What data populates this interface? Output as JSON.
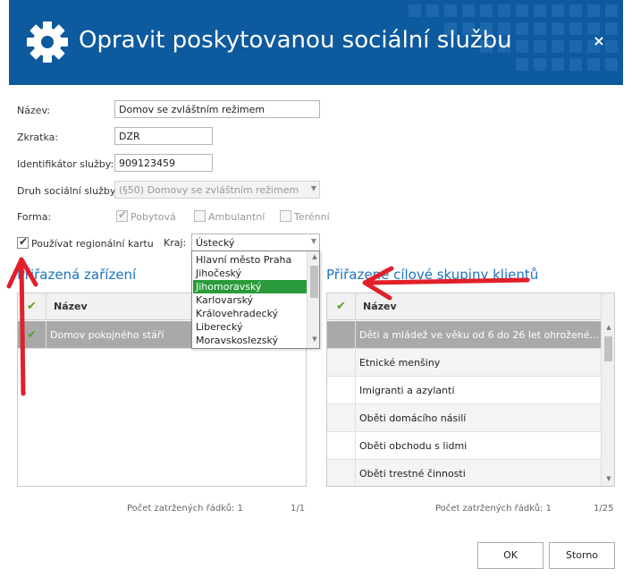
{
  "dialog": {
    "title": "Opravit poskytovanou sociální službu",
    "close_label": "×",
    "accent": "#0e5a9e",
    "gear_icon": "gear-icon"
  },
  "form": {
    "nazev_label": "Název:",
    "nazev_value": "Domov se zvláštním režimem",
    "zkratka_label": "Zkratka:",
    "zkratka_value": "DZR",
    "identifikator_label": "Identifikátor služby:",
    "identifikator_value": "909123459",
    "druh_label": "Druh sociální služby:",
    "druh_value": "(§50) Domovy se zvláštním režimem",
    "forma_label": "Forma:",
    "forma_options": [
      {
        "label": "Pobytová",
        "checked": true
      },
      {
        "label": "Ambulantní",
        "checked": false
      },
      {
        "label": "Terénní",
        "checked": false
      }
    ],
    "regional_label": "Používat regionální kartu",
    "regional_checked": true,
    "kraj_label": "Kraj:",
    "kraj_value": "Ústecký"
  },
  "kraj_dropdown": {
    "items": [
      "Hlavní město Praha",
      "Jihočeský",
      "Jihomoravský",
      "Karlovarský",
      "Královehradecký",
      "Liberecký",
      "Moravskoslezský"
    ],
    "selected_index": 2,
    "selected_color": "#2a9b3a"
  },
  "zarizeni": {
    "title": "Přiřazená zařízení",
    "column": "Název",
    "rows": [
      "Domov pokojného stáří"
    ],
    "count_text": "Počet zatržených řádků: 1",
    "page_text": "1/1"
  },
  "skupiny": {
    "title": "Přiřazené cílové skupiny klientů",
    "column": "Název",
    "rows": [
      "Děti a mládež ve věku od 6 do 26 let ohrožené...",
      "Etnické menšiny",
      "Imigranti a azylanti",
      "Oběti domácího násilí",
      "Oběti obchodu s lidmi",
      "Oběti trestné činnosti"
    ],
    "count_text": "Počet zatržených řádků: 1",
    "page_text": "1/25"
  },
  "buttons": {
    "ok": "OK",
    "storno": "Storno"
  },
  "annotation_color": "#e0202a"
}
